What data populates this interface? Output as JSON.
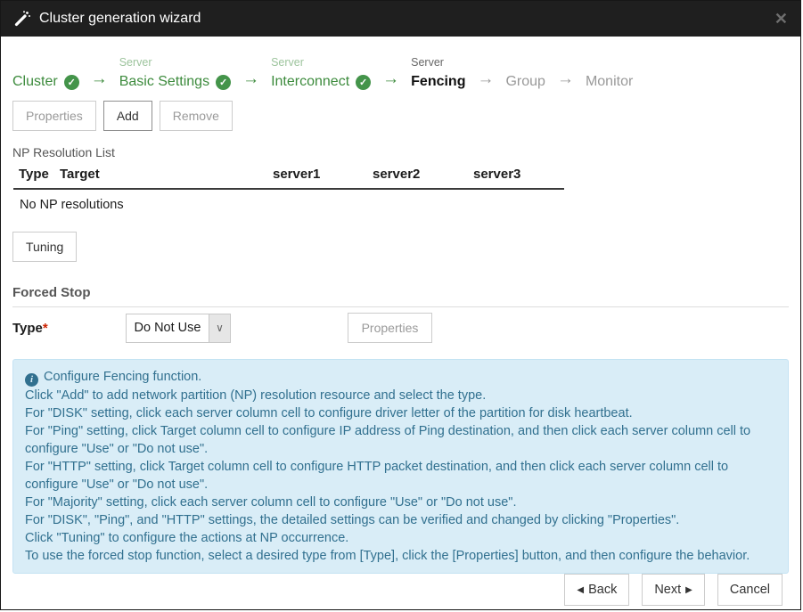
{
  "title_bar": {
    "title": "Cluster generation wizard"
  },
  "icons": {
    "close": "✕",
    "arrow_right": "→",
    "check": "✓",
    "chevron_down": "∨",
    "info": "i",
    "back_triangle": "◀",
    "next_triangle": "▶"
  },
  "wizard_steps": [
    {
      "group": "",
      "label": "Cluster",
      "state": "done"
    },
    {
      "group": "Server",
      "label": "Basic Settings",
      "state": "done"
    },
    {
      "group": "Server",
      "label": "Interconnect",
      "state": "done"
    },
    {
      "group": "Server",
      "label": "Fencing",
      "state": "current"
    },
    {
      "group": "",
      "label": "Group",
      "state": "future"
    },
    {
      "group": "",
      "label": "Monitor",
      "state": "future"
    }
  ],
  "toolbar": {
    "properties_label": "Properties",
    "add_label": "Add",
    "remove_label": "Remove"
  },
  "np_list": {
    "label": "NP Resolution List",
    "columns": [
      "Type",
      "Target",
      "server1",
      "server2",
      "server3"
    ],
    "empty_text": "No NP resolutions",
    "tuning_label": "Tuning"
  },
  "forced_stop": {
    "heading": "Forced Stop",
    "type_label": "Type",
    "required_marker": "*",
    "type_value": "Do Not Use",
    "properties_label": "Properties"
  },
  "info_box": {
    "lines": [
      "Configure Fencing function.",
      "Click \"Add\" to add network partition (NP) resolution resource and select the type.",
      "For \"DISK\" setting, click each server column cell to configure driver letter of the partition for disk heartbeat.",
      "For \"Ping\" setting, click Target column cell to configure IP address of Ping destination, and then click each server column cell to configure \"Use\" or \"Do not use\".",
      "For \"HTTP\" setting, click Target column cell to configure HTTP packet destination, and then click each server column cell to configure \"Use\" or \"Do not use\".",
      "For \"Majority\" setting, click each server column cell to configure \"Use\" or \"Do not use\".",
      "For \"DISK\", \"Ping\", and \"HTTP\" settings, the detailed settings can be verified and changed by clicking \"Properties\".",
      "Click \"Tuning\" to configure the actions at NP occurrence.",
      "To use the forced stop function, select a desired type from [Type], click the [Properties] button, and then configure the behavior."
    ]
  },
  "footer": {
    "back_label": "Back",
    "next_label": "Next",
    "cancel_label": "Cancel"
  },
  "colors": {
    "title_bar_bg": "#1f1f1f",
    "accent_green": "#3d8b3d",
    "check_green": "#44944a",
    "info_bg": "#d9edf7",
    "info_text": "#31708f",
    "required_red": "#cc2200"
  }
}
